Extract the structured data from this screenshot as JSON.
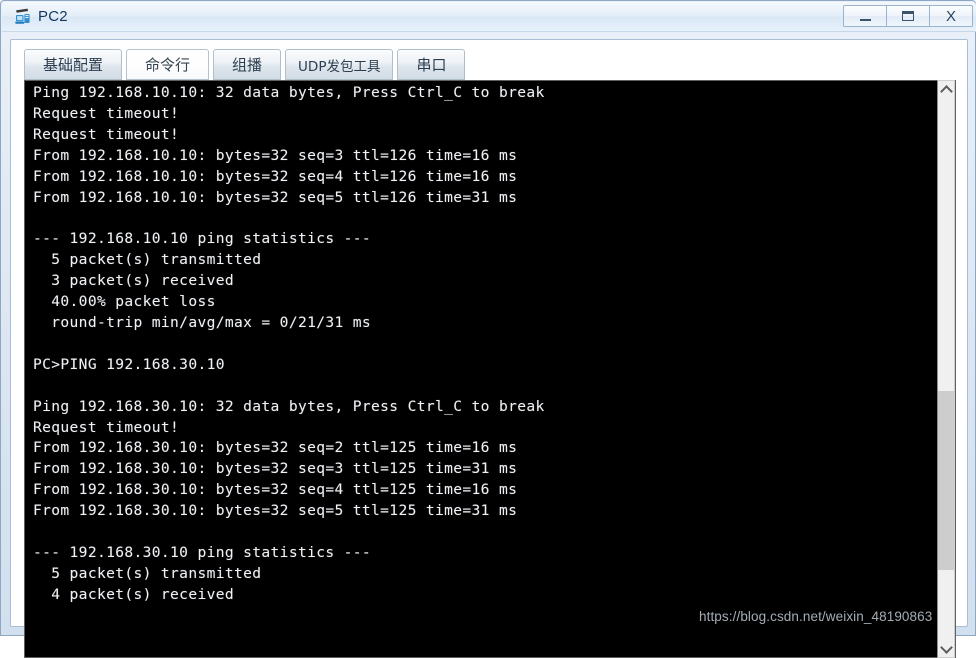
{
  "window": {
    "title": "PC2",
    "icon": "pc-device-icon",
    "controls": {
      "minimize_label": "–",
      "maximize_label": "▭",
      "close_label": "X"
    }
  },
  "tabs": [
    {
      "label": "基础配置",
      "name": "tab-basic-config",
      "active": false
    },
    {
      "label": "命令行",
      "name": "tab-command-line",
      "active": true
    },
    {
      "label": "组播",
      "name": "tab-multicast",
      "active": false
    },
    {
      "label": "UDP发包工具",
      "name": "tab-udp-tool",
      "active": false
    },
    {
      "label": "串口",
      "name": "tab-serial-port",
      "active": false
    }
  ],
  "terminal": {
    "lines": [
      "Ping 192.168.10.10: 32 data bytes, Press Ctrl_C to break",
      "Request timeout!",
      "Request timeout!",
      "From 192.168.10.10: bytes=32 seq=3 ttl=126 time=16 ms",
      "From 192.168.10.10: bytes=32 seq=4 ttl=126 time=16 ms",
      "From 192.168.10.10: bytes=32 seq=5 ttl=126 time=31 ms",
      "",
      "--- 192.168.10.10 ping statistics ---",
      "  5 packet(s) transmitted",
      "  3 packet(s) received",
      "  40.00% packet loss",
      "  round-trip min/avg/max = 0/21/31 ms",
      "",
      "PC>PING 192.168.30.10",
      "",
      "Ping 192.168.30.10: 32 data bytes, Press Ctrl_C to break",
      "Request timeout!",
      "From 192.168.30.10: bytes=32 seq=2 ttl=125 time=16 ms",
      "From 192.168.30.10: bytes=32 seq=3 ttl=125 time=31 ms",
      "From 192.168.30.10: bytes=32 seq=4 ttl=125 time=16 ms",
      "From 192.168.30.10: bytes=32 seq=5 ttl=125 time=31 ms",
      "",
      "--- 192.168.30.10 ping statistics ---",
      "  5 packet(s) transmitted",
      "  4 packet(s) received"
    ],
    "text_color": "#f1f1f1",
    "background_color": "#000000"
  },
  "scrollbar": {
    "up_arrow": "chevron-up-icon",
    "down_arrow": "chevron-down-icon",
    "thumb_top_pct": 54,
    "thumb_height_pct": 33
  },
  "watermark": {
    "text": "https://blog.csdn.net/weixin_48190863"
  }
}
